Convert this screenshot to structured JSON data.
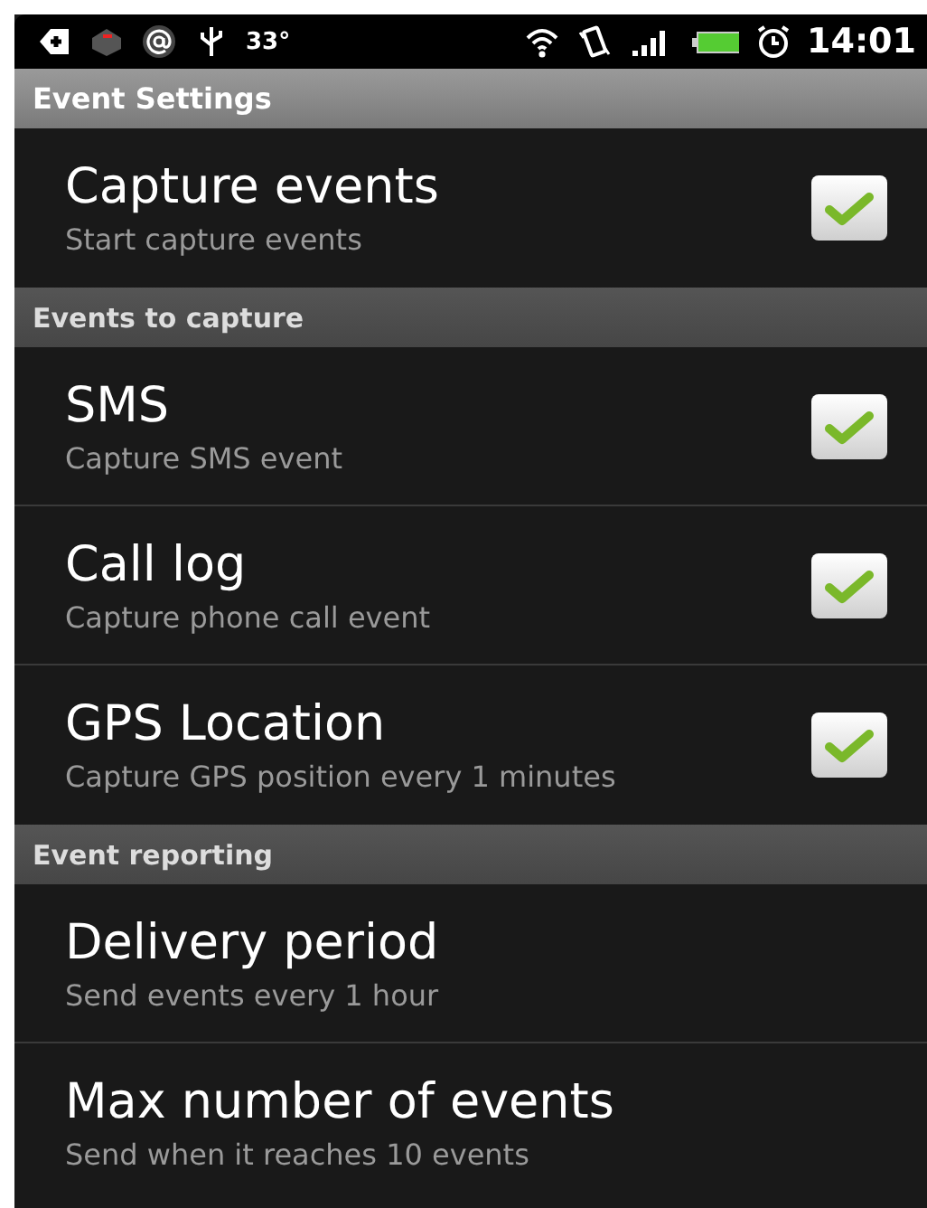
{
  "status_bar": {
    "temperature": "33°",
    "time": "14:01"
  },
  "title": "Event Settings",
  "sections": [
    {
      "items": [
        {
          "kind": "checkbox",
          "title": "Capture events",
          "summary": "Start capture events",
          "checked": true
        }
      ]
    },
    {
      "header": "Events to capture",
      "items": [
        {
          "kind": "checkbox",
          "title": "SMS",
          "summary": "Capture SMS event",
          "checked": true
        },
        {
          "kind": "checkbox",
          "title": "Call log",
          "summary": "Capture phone call event",
          "checked": true
        },
        {
          "kind": "checkbox",
          "title": "GPS Location",
          "summary": "Capture GPS position every 1 minutes",
          "checked": true
        }
      ]
    },
    {
      "header": "Event reporting",
      "items": [
        {
          "kind": "plain",
          "title": "Delivery period",
          "summary": "Send events every 1 hour"
        },
        {
          "kind": "plain",
          "title": "Max number of events",
          "summary": "Send when it reaches 10 events"
        }
      ]
    }
  ]
}
